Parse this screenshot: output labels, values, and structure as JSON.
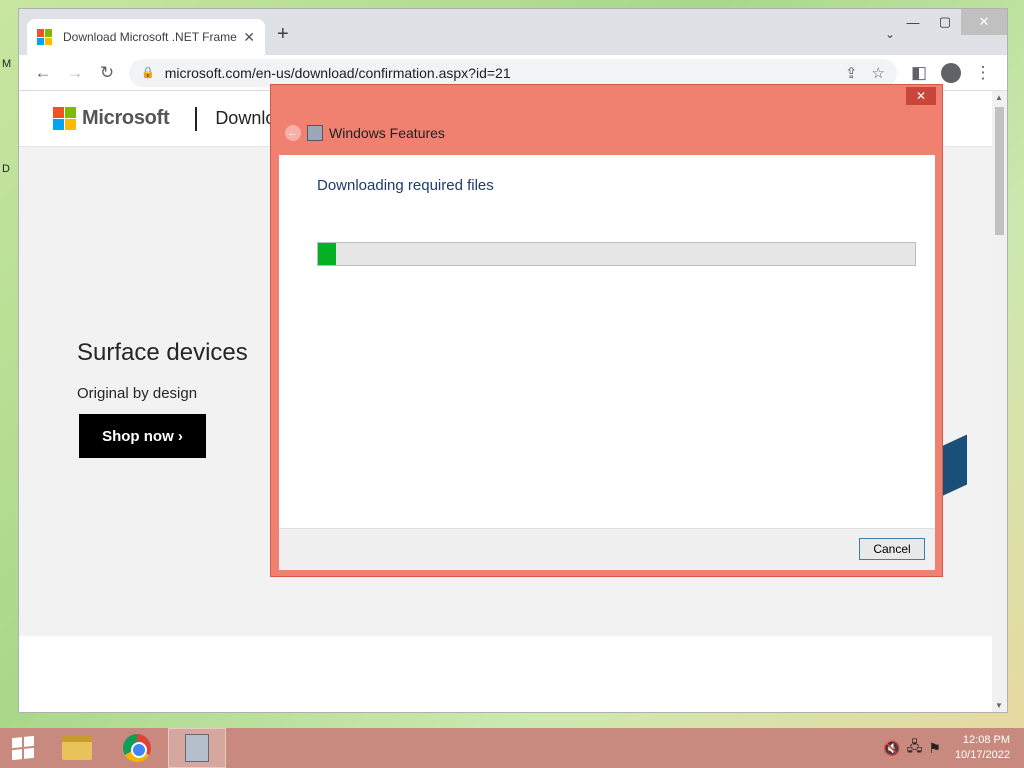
{
  "desktop": {
    "frag_top": "M",
    "frag_bottom": "D"
  },
  "browser": {
    "tab_title": "Download Microsoft .NET Frame",
    "url": "microsoft.com/en-us/download/confirmation.aspx?id=21"
  },
  "page": {
    "brand": "Microsoft",
    "nav_label": "Downlo",
    "promo_title": "Surface devices",
    "promo_subtitle": "Original by design",
    "shop_button": "Shop now ›"
  },
  "dialog": {
    "title": "Windows Features",
    "heading": "Downloading required files",
    "progress_percent": 3,
    "cancel_label": "Cancel",
    "close_symbol": "✕"
  },
  "taskbar": {
    "time": "12:08 PM",
    "date": "10/17/2022"
  },
  "colors": {
    "dialog_frame": "#f08070",
    "progress_fill": "#06b025",
    "taskbar": "#c88a7e"
  }
}
